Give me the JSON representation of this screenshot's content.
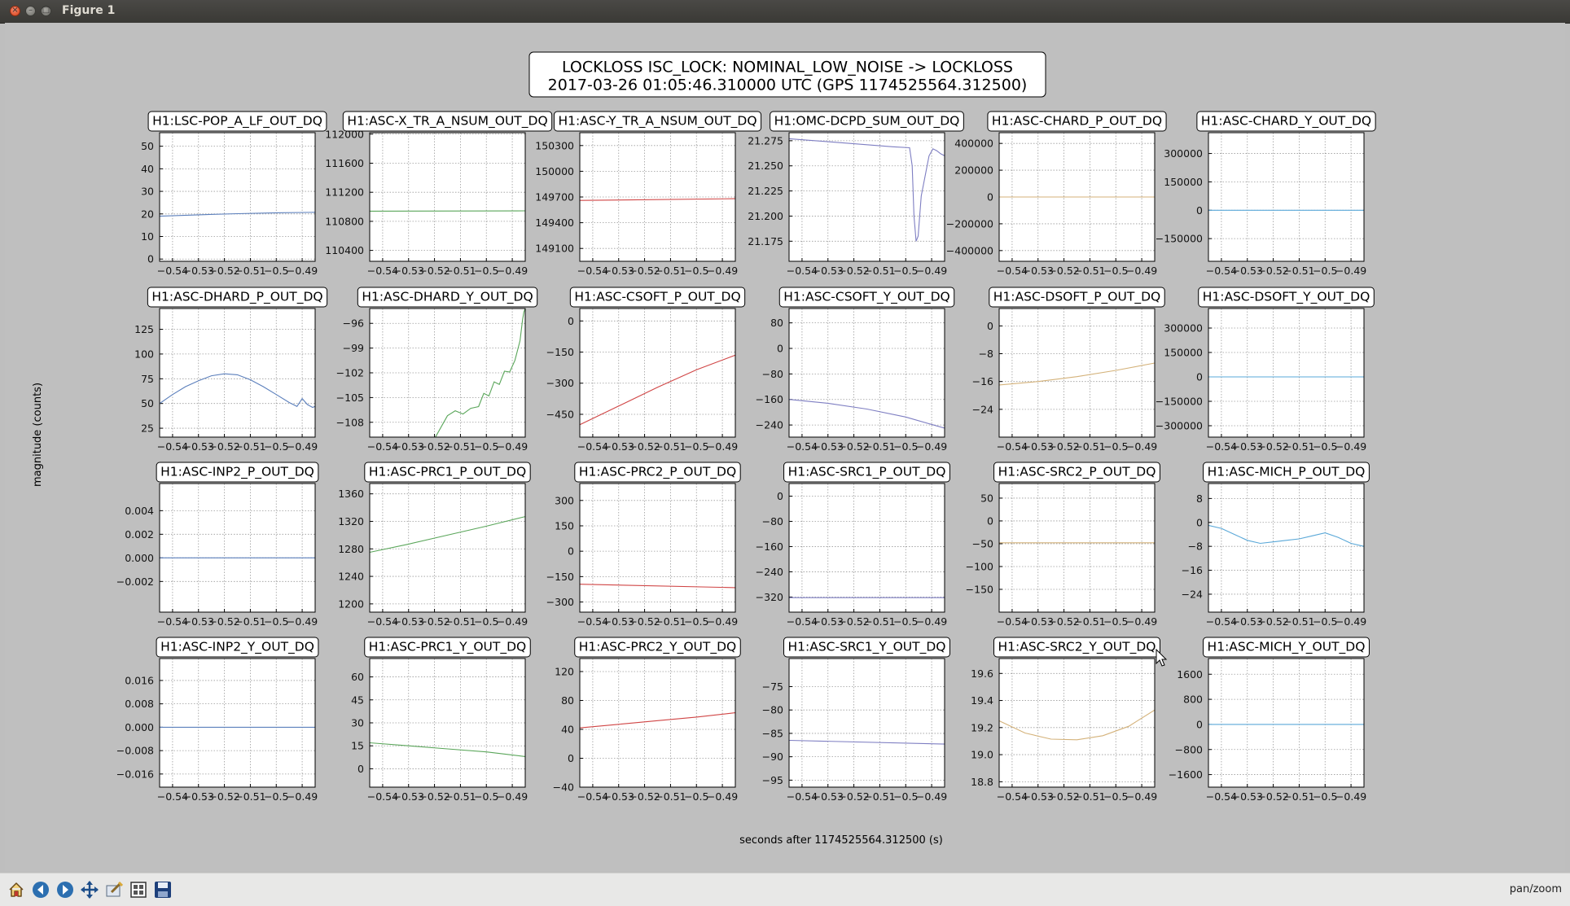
{
  "window": {
    "title": "Figure 1"
  },
  "figure": {
    "suptitle_line1": "LOCKLOSS ISC_LOCK: NOMINAL_LOW_NOISE -> LOCKLOSS",
    "suptitle_line2": "2017-03-26 01:05:46.310000 UTC (GPS 1174525564.312500)",
    "ylabel": "magnitude (counts)",
    "xlabel": "seconds after 1174525564.312500 (s)"
  },
  "toolbar": {
    "buttons": [
      "home-icon",
      "back-icon",
      "forward-icon",
      "pan-icon",
      "zoom-icon",
      "subplots-icon",
      "save-icon"
    ],
    "mode_text": "pan/zoom"
  },
  "colors": {
    "blue": "#5b7fbc",
    "green": "#5aa65a",
    "red": "#d04545",
    "purple": "#7e7ec2",
    "tan": "#d4b27a",
    "cyan": "#5aa8d8"
  },
  "chart_data": [
    {
      "type": "line",
      "title": "H1:LSC-POP_A_LF_OUT_DQ",
      "color": "blue",
      "xlim": [
        -0.545,
        -0.485
      ],
      "xticks": [
        "-0.54",
        "-0.53",
        "-0.52",
        "-0.51",
        "-0.5",
        "-0.49"
      ],
      "ylim": [
        -1,
        56
      ],
      "yticks": [
        0,
        10,
        20,
        30,
        40,
        50
      ],
      "ytick_labels": [
        "0",
        "10",
        "20",
        "30",
        "40",
        "50"
      ],
      "x": [
        -0.545,
        -0.53,
        -0.515,
        -0.5,
        -0.485
      ],
      "y": [
        19,
        19.6,
        20.1,
        20.5,
        20.7
      ]
    },
    {
      "type": "line",
      "title": "H1:ASC-X_TR_A_NSUM_OUT_DQ",
      "color": "green",
      "xlim": [
        -0.545,
        -0.485
      ],
      "xticks": [
        "-0.54",
        "-0.53",
        "-0.52",
        "-0.51",
        "-0.5",
        "-0.49"
      ],
      "ylim": [
        110250,
        112020
      ],
      "yticks": [
        110400,
        110800,
        111200,
        111600,
        112000
      ],
      "ytick_labels": [
        "110400",
        "110800",
        "111200",
        "111600",
        "112000"
      ],
      "x": [
        -0.545,
        -0.485
      ],
      "y": [
        110940,
        110945
      ]
    },
    {
      "type": "line",
      "title": "H1:ASC-Y_TR_A_NSUM_OUT_DQ",
      "color": "red",
      "xlim": [
        -0.545,
        -0.485
      ],
      "xticks": [
        "-0.54",
        "-0.53",
        "-0.52",
        "-0.51",
        "-0.5",
        "-0.49"
      ],
      "ylim": [
        148950,
        150450
      ],
      "yticks": [
        149100,
        149400,
        149700,
        150000,
        150300
      ],
      "ytick_labels": [
        "149100",
        "149400",
        "149700",
        "150000",
        "150300"
      ],
      "x": [
        -0.545,
        -0.485
      ],
      "y": [
        149660,
        149680
      ]
    },
    {
      "type": "line",
      "title": "H1:OMC-DCPD_SUM_OUT_DQ",
      "color": "purple",
      "xlim": [
        -0.545,
        -0.485
      ],
      "xticks": [
        "-0.54",
        "-0.53",
        "-0.52",
        "-0.51",
        "-0.5",
        "-0.49"
      ],
      "ylim": [
        21.155,
        21.283
      ],
      "yticks": [
        21.175,
        21.2,
        21.225,
        21.25,
        21.275
      ],
      "ytick_labels": [
        "21.175",
        "21.200",
        "21.225",
        "21.250",
        "21.275"
      ],
      "x": [
        -0.545,
        -0.53,
        -0.515,
        -0.505,
        -0.4985,
        -0.4975,
        -0.4968,
        -0.496,
        -0.4952,
        -0.494,
        -0.4925,
        -0.491,
        -0.4895,
        -0.488,
        -0.4865,
        -0.485
      ],
      "y": [
        21.277,
        21.274,
        21.271,
        21.269,
        21.268,
        21.25,
        21.2,
        21.175,
        21.18,
        21.22,
        21.24,
        21.26,
        21.267,
        21.265,
        21.262,
        21.26
      ]
    },
    {
      "type": "line",
      "title": "H1:ASC-CHARD_P_OUT_DQ",
      "color": "tan",
      "xlim": [
        -0.545,
        -0.485
      ],
      "xticks": [
        "-0.54",
        "-0.53",
        "-0.52",
        "-0.51",
        "-0.5",
        "-0.49"
      ],
      "ylim": [
        -480000,
        480000
      ],
      "yticks": [
        -400000,
        -200000,
        0,
        200000,
        400000
      ],
      "ytick_labels": [
        "-400000",
        "-200000",
        "0",
        "200000",
        "400000"
      ],
      "x": [
        -0.545,
        -0.485
      ],
      "y": [
        0,
        0
      ]
    },
    {
      "type": "line",
      "title": "H1:ASC-CHARD_Y_OUT_DQ",
      "color": "cyan",
      "xlim": [
        -0.545,
        -0.485
      ],
      "xticks": [
        "-0.54",
        "-0.53",
        "-0.52",
        "-0.51",
        "-0.5",
        "-0.49"
      ],
      "ylim": [
        -270000,
        410000
      ],
      "yticks": [
        -150000,
        0,
        150000,
        300000
      ],
      "ytick_labels": [
        "-150000",
        "0",
        "150000",
        "300000"
      ],
      "x": [
        -0.545,
        -0.485
      ],
      "y": [
        0,
        0
      ]
    },
    {
      "type": "line",
      "title": "H1:ASC-DHARD_P_OUT_DQ",
      "color": "blue",
      "xlim": [
        -0.545,
        -0.485
      ],
      "xticks": [
        "-0.54",
        "-0.53",
        "-0.52",
        "-0.51",
        "-0.5",
        "-0.49"
      ],
      "ylim": [
        16,
        146
      ],
      "yticks": [
        25,
        50,
        75,
        100,
        125
      ],
      "ytick_labels": [
        "25",
        "50",
        "75",
        "100",
        "125"
      ],
      "x": [
        -0.545,
        -0.54,
        -0.535,
        -0.53,
        -0.525,
        -0.52,
        -0.515,
        -0.51,
        -0.505,
        -0.5,
        -0.495,
        -0.492,
        -0.49,
        -0.488,
        -0.486,
        -0.485
      ],
      "y": [
        50,
        59,
        67,
        73,
        78,
        80,
        79,
        74,
        67,
        59,
        51,
        47,
        55,
        49,
        46,
        47
      ]
    },
    {
      "type": "line",
      "title": "H1:ASC-DHARD_Y_OUT_DQ",
      "color": "green",
      "xlim": [
        -0.545,
        -0.485
      ],
      "xticks": [
        "-0.54",
        "-0.53",
        "-0.52",
        "-0.51",
        "-0.5",
        "-0.49"
      ],
      "ylim": [
        -109.8,
        -94.2
      ],
      "yticks": [
        -108,
        -105,
        -102,
        -99,
        -96
      ],
      "ytick_labels": [
        "-108",
        "-105",
        "-102",
        "-99",
        "-96"
      ],
      "x": [
        -0.52,
        -0.515,
        -0.512,
        -0.509,
        -0.506,
        -0.503,
        -0.501,
        -0.499,
        -0.497,
        -0.495,
        -0.493,
        -0.491,
        -0.489,
        -0.487,
        -0.486,
        -0.4855,
        -0.485
      ],
      "y": [
        -110,
        -107.2,
        -106.6,
        -107,
        -106.3,
        -106.1,
        -104.5,
        -104.8,
        -103.1,
        -103.4,
        -101.8,
        -101.9,
        -100.5,
        -98.1,
        -95.5,
        -94.6,
        -94.2
      ]
    },
    {
      "type": "line",
      "title": "H1:ASC-CSOFT_P_OUT_DQ",
      "color": "red",
      "xlim": [
        -0.545,
        -0.485
      ],
      "xticks": [
        "-0.54",
        "-0.53",
        "-0.52",
        "-0.51",
        "-0.5",
        "-0.49"
      ],
      "ylim": [
        -560,
        60
      ],
      "yticks": [
        -450,
        -300,
        -150,
        0
      ],
      "ytick_labels": [
        "-450",
        "-300",
        "-150",
        "0"
      ],
      "x": [
        -0.545,
        -0.53,
        -0.515,
        -0.5,
        -0.485
      ],
      "y": [
        -500,
        -410,
        -320,
        -235,
        -165
      ]
    },
    {
      "type": "line",
      "title": "H1:ASC-CSOFT_Y_OUT_DQ",
      "color": "purple",
      "xlim": [
        -0.545,
        -0.485
      ],
      "xticks": [
        "-0.54",
        "-0.53",
        "-0.52",
        "-0.51",
        "-0.5",
        "-0.49"
      ],
      "ylim": [
        -278,
        125
      ],
      "yticks": [
        -240,
        -160,
        -80,
        0,
        80
      ],
      "ytick_labels": [
        "-240",
        "-160",
        "-80",
        "0",
        "80"
      ],
      "x": [
        -0.545,
        -0.53,
        -0.515,
        -0.5,
        -0.485
      ],
      "y": [
        -160,
        -172,
        -190,
        -215,
        -250
      ]
    },
    {
      "type": "line",
      "title": "H1:ASC-DSOFT_P_OUT_DQ",
      "color": "tan",
      "xlim": [
        -0.545,
        -0.485
      ],
      "xticks": [
        "-0.54",
        "-0.53",
        "-0.52",
        "-0.51",
        "-0.5",
        "-0.49"
      ],
      "ylim": [
        -32,
        5
      ],
      "yticks": [
        -24,
        -16,
        -8,
        0
      ],
      "ytick_labels": [
        "-24",
        "-16",
        "-8",
        "0"
      ],
      "x": [
        -0.545,
        -0.53,
        -0.515,
        -0.5,
        -0.485
      ],
      "y": [
        -17,
        -16,
        -14.6,
        -12.8,
        -10.7
      ]
    },
    {
      "type": "line",
      "title": "H1:ASC-DSOFT_Y_OUT_DQ",
      "color": "cyan",
      "xlim": [
        -0.545,
        -0.485
      ],
      "xticks": [
        "-0.54",
        "-0.53",
        "-0.52",
        "-0.51",
        "-0.5",
        "-0.49"
      ],
      "ylim": [
        -370000,
        420000
      ],
      "yticks": [
        -300000,
        -150000,
        0,
        150000,
        300000
      ],
      "ytick_labels": [
        "-300000",
        "-150000",
        "0",
        "150000",
        "300000"
      ],
      "x": [
        -0.545,
        -0.485
      ],
      "y": [
        0,
        0
      ]
    },
    {
      "type": "line",
      "title": "H1:ASC-INP2_P_OUT_DQ",
      "color": "blue",
      "xlim": [
        -0.545,
        -0.485
      ],
      "xticks": [
        "-0.54",
        "-0.53",
        "-0.52",
        "-0.51",
        "-0.5",
        "-0.49"
      ],
      "ylim": [
        -0.0046,
        0.0063
      ],
      "yticks": [
        -0.002,
        0,
        0.002,
        0.004
      ],
      "ytick_labels": [
        "-0.002",
        "0.000",
        "0.002",
        "0.004"
      ],
      "x": [
        -0.545,
        -0.485
      ],
      "y": [
        0,
        0
      ]
    },
    {
      "type": "line",
      "title": "H1:ASC-PRC1_P_OUT_DQ",
      "color": "green",
      "xlim": [
        -0.545,
        -0.485
      ],
      "xticks": [
        "-0.54",
        "-0.53",
        "-0.52",
        "-0.51",
        "-0.5",
        "-0.49"
      ],
      "ylim": [
        1188,
        1375
      ],
      "yticks": [
        1200,
        1240,
        1280,
        1320,
        1360
      ],
      "ytick_labels": [
        "1200",
        "1240",
        "1280",
        "1320",
        "1360"
      ],
      "x": [
        -0.545,
        -0.53,
        -0.515,
        -0.5,
        -0.485
      ],
      "y": [
        1275,
        1287,
        1300,
        1313,
        1327
      ]
    },
    {
      "type": "line",
      "title": "H1:ASC-PRC2_P_OUT_DQ",
      "color": "red",
      "xlim": [
        -0.545,
        -0.485
      ],
      "xticks": [
        "-0.54",
        "-0.53",
        "-0.52",
        "-0.51",
        "-0.5",
        "-0.49"
      ],
      "ylim": [
        -360,
        400
      ],
      "yticks": [
        -300,
        -150,
        0,
        150,
        300
      ],
      "ytick_labels": [
        "-300",
        "-150",
        "0",
        "150",
        "300"
      ],
      "x": [
        -0.545,
        -0.485
      ],
      "y": [
        -195,
        -215
      ]
    },
    {
      "type": "line",
      "title": "H1:ASC-SRC1_P_OUT_DQ",
      "color": "purple",
      "xlim": [
        -0.545,
        -0.485
      ],
      "xticks": [
        "-0.54",
        "-0.53",
        "-0.52",
        "-0.51",
        "-0.5",
        "-0.49"
      ],
      "ylim": [
        -368,
        40
      ],
      "yticks": [
        -320,
        -240,
        -160,
        -80,
        0
      ],
      "ytick_labels": [
        "-320",
        "-240",
        "-160",
        "-80",
        "0"
      ],
      "x": [
        -0.545,
        -0.485
      ],
      "y": [
        -322,
        -322
      ]
    },
    {
      "type": "line",
      "title": "H1:ASC-SRC2_P_OUT_DQ",
      "color": "tan",
      "xlim": [
        -0.545,
        -0.485
      ],
      "xticks": [
        "-0.54",
        "-0.53",
        "-0.52",
        "-0.51",
        "-0.5",
        "-0.49"
      ],
      "ylim": [
        -200,
        82
      ],
      "yticks": [
        -150,
        -100,
        -50,
        0,
        50
      ],
      "ytick_labels": [
        "-150",
        "-100",
        "-50",
        "0",
        "50"
      ],
      "x": [
        -0.545,
        -0.485
      ],
      "y": [
        -48,
        -48
      ]
    },
    {
      "type": "line",
      "title": "H1:ASC-MICH_P_OUT_DQ",
      "color": "cyan",
      "xlim": [
        -0.545,
        -0.485
      ],
      "xticks": [
        "-0.54",
        "-0.53",
        "-0.52",
        "-0.51",
        "-0.5",
        "-0.49"
      ],
      "ylim": [
        -30,
        13
      ],
      "yticks": [
        -24,
        -16,
        -8,
        0,
        8
      ],
      "ytick_labels": [
        "-24",
        "-16",
        "-8",
        "0",
        "8"
      ],
      "x": [
        -0.545,
        -0.54,
        -0.535,
        -0.53,
        -0.525,
        -0.52,
        -0.515,
        -0.51,
        -0.505,
        -0.5,
        -0.495,
        -0.49,
        -0.485
      ],
      "y": [
        -1,
        -2,
        -4,
        -6,
        -7,
        -6.5,
        -6,
        -5.5,
        -4.5,
        -3.5,
        -5,
        -7,
        -8
      ]
    },
    {
      "type": "line",
      "title": "H1:ASC-INP2_Y_OUT_DQ",
      "color": "blue",
      "xlim": [
        -0.545,
        -0.485
      ],
      "xticks": [
        "-0.54",
        "-0.53",
        "-0.52",
        "-0.51",
        "-0.5",
        "-0.49"
      ],
      "ylim": [
        -0.0205,
        0.0235
      ],
      "yticks": [
        -0.016,
        -0.008,
        0,
        0.008,
        0.016
      ],
      "ytick_labels": [
        "-0.016",
        "-0.008",
        "0.000",
        "0.008",
        "0.016"
      ],
      "x": [
        -0.545,
        -0.485
      ],
      "y": [
        0,
        0
      ]
    },
    {
      "type": "line",
      "title": "H1:ASC-PRC1_Y_OUT_DQ",
      "color": "green",
      "xlim": [
        -0.545,
        -0.485
      ],
      "xticks": [
        "-0.54",
        "-0.53",
        "-0.52",
        "-0.51",
        "-0.5",
        "-0.49"
      ],
      "ylim": [
        -12,
        72
      ],
      "yticks": [
        0,
        15,
        30,
        45,
        60
      ],
      "ytick_labels": [
        "0",
        "15",
        "30",
        "45",
        "60"
      ],
      "x": [
        -0.545,
        -0.53,
        -0.515,
        -0.5,
        -0.485
      ],
      "y": [
        17,
        15,
        13,
        11,
        8
      ]
    },
    {
      "type": "line",
      "title": "H1:ASC-PRC2_Y_OUT_DQ",
      "color": "red",
      "xlim": [
        -0.545,
        -0.485
      ],
      "xticks": [
        "-0.54",
        "-0.53",
        "-0.52",
        "-0.51",
        "-0.5",
        "-0.49"
      ],
      "ylim": [
        -40,
        138
      ],
      "yticks": [
        -40,
        0,
        40,
        80,
        120
      ],
      "ytick_labels": [
        "-40",
        "0",
        "40",
        "80",
        "120"
      ],
      "x": [
        -0.545,
        -0.53,
        -0.515,
        -0.5,
        -0.485
      ],
      "y": [
        42,
        47,
        52,
        57,
        63
      ]
    },
    {
      "type": "line",
      "title": "H1:ASC-SRC1_Y_OUT_DQ",
      "color": "purple",
      "xlim": [
        -0.545,
        -0.485
      ],
      "xticks": [
        "-0.54",
        "-0.53",
        "-0.52",
        "-0.51",
        "-0.5",
        "-0.49"
      ],
      "ylim": [
        -96.5,
        -69
      ],
      "yticks": [
        -95,
        -90,
        -85,
        -80,
        -75
      ],
      "ytick_labels": [
        "-95",
        "-90",
        "-85",
        "-80",
        "-75"
      ],
      "x": [
        -0.545,
        -0.485
      ],
      "y": [
        -86.5,
        -87.3
      ]
    },
    {
      "type": "line",
      "title": "H1:ASC-SRC2_Y_OUT_DQ",
      "color": "tan",
      "xlim": [
        -0.545,
        -0.485
      ],
      "xticks": [
        "-0.54",
        "-0.53",
        "-0.52",
        "-0.51",
        "-0.5",
        "-0.49"
      ],
      "ylim": [
        18.76,
        19.71
      ],
      "yticks": [
        18.8,
        19.0,
        19.2,
        19.4,
        19.6
      ],
      "ytick_labels": [
        "18.8",
        "19.0",
        "19.2",
        "19.4",
        "19.6"
      ],
      "x": [
        -0.545,
        -0.535,
        -0.525,
        -0.515,
        -0.505,
        -0.495,
        -0.485
      ],
      "y": [
        19.25,
        19.16,
        19.115,
        19.11,
        19.14,
        19.21,
        19.33
      ]
    },
    {
      "type": "line",
      "title": "H1:ASC-MICH_Y_OUT_DQ",
      "color": "cyan",
      "xlim": [
        -0.545,
        -0.485
      ],
      "xticks": [
        "-0.54",
        "-0.53",
        "-0.52",
        "-0.51",
        "-0.5",
        "-0.49"
      ],
      "ylim": [
        -2000,
        2100
      ],
      "yticks": [
        -1600,
        -800,
        0,
        800,
        1600
      ],
      "ytick_labels": [
        "-1600",
        "-800",
        "0",
        "800",
        "1600"
      ],
      "x": [
        -0.545,
        -0.485
      ],
      "y": [
        0,
        0
      ]
    }
  ]
}
